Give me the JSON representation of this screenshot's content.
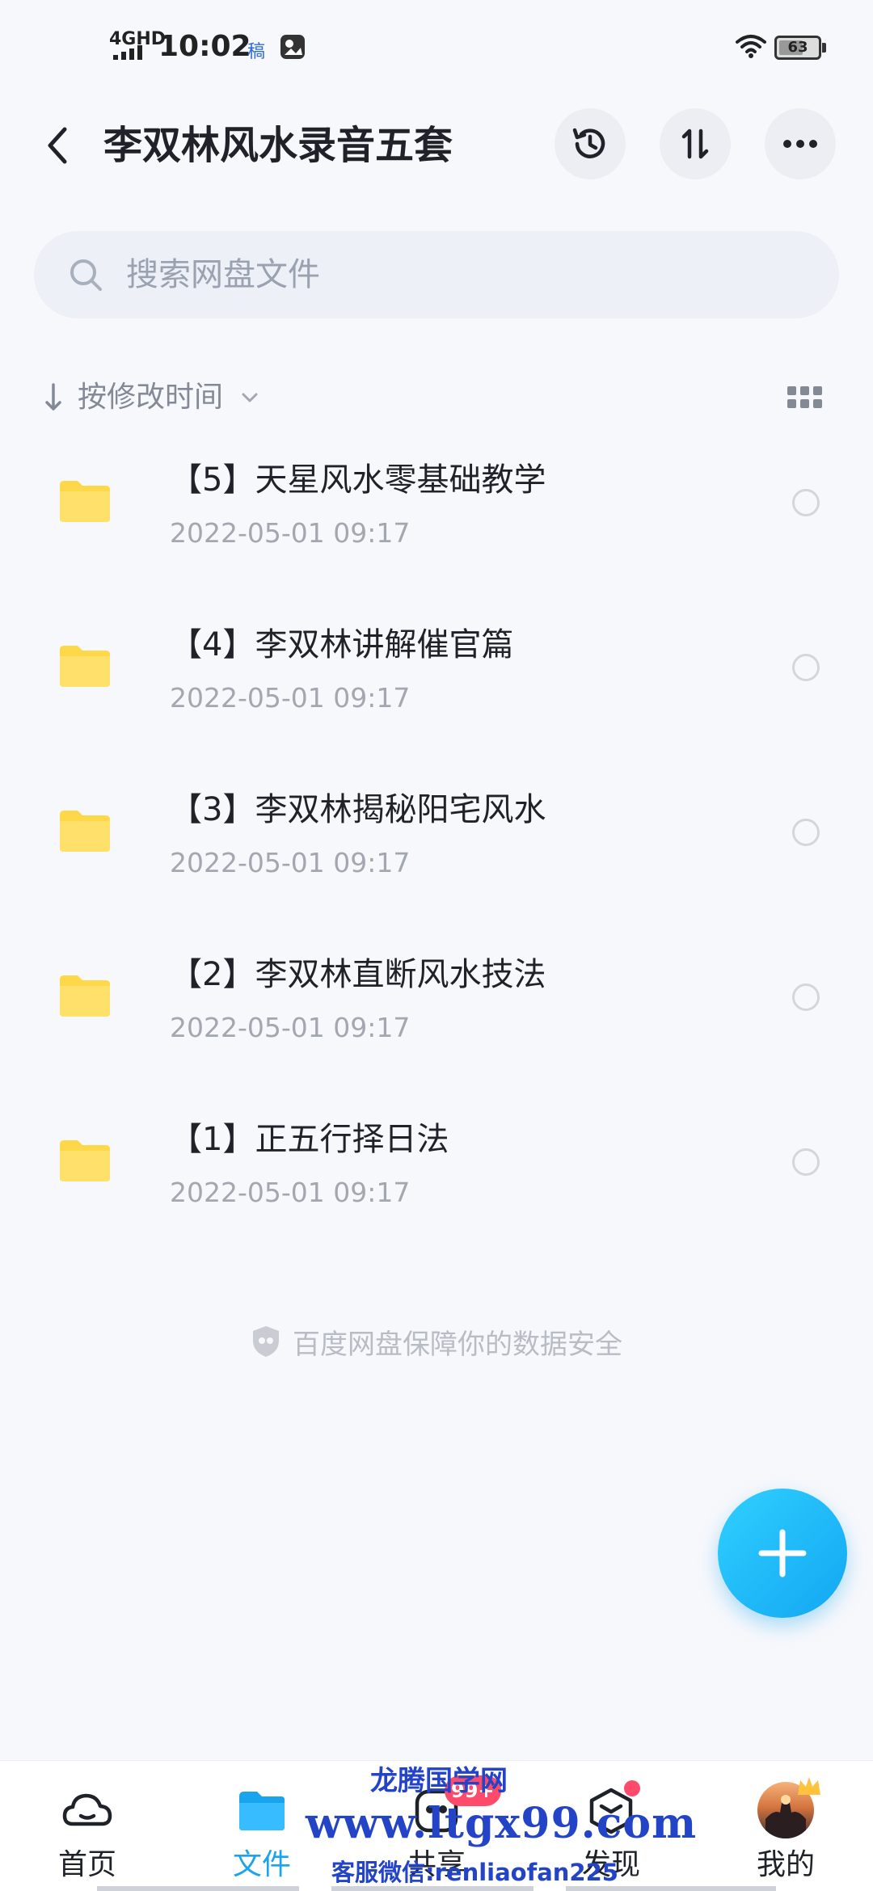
{
  "status_bar": {
    "network": "4GHD",
    "time": "10:02",
    "notification_glyph": "稿",
    "battery": "63",
    "battery_level": 0.63
  },
  "header": {
    "title": "李双林风水录音五套",
    "back_icon": "chevron-left-icon",
    "actions": [
      "history-icon",
      "sort-icon",
      "more-icon"
    ]
  },
  "search": {
    "placeholder": "搜索网盘文件"
  },
  "sort": {
    "label": "按修改时间",
    "view_icon": "grid-view-icon"
  },
  "files": [
    {
      "name": "【5】天星风水零基础教学",
      "date": "2022-05-01  09:17",
      "type": "folder"
    },
    {
      "name": "【4】李双林讲解催官篇",
      "date": "2022-05-01  09:17",
      "type": "folder"
    },
    {
      "name": "【3】李双林揭秘阳宅风水",
      "date": "2022-05-01  09:17",
      "type": "folder"
    },
    {
      "name": "【2】李双林直断风水技法",
      "date": "2022-05-01  09:17",
      "type": "folder"
    },
    {
      "name": "【1】正五行择日法",
      "date": "2022-05-01  09:17",
      "type": "folder"
    }
  ],
  "footer_note": "百度网盘保障你的数据安全",
  "fab_icon": "plus-icon",
  "bottom_nav": {
    "items": [
      {
        "label": "首页",
        "icon": "cloud-home-icon",
        "active": false
      },
      {
        "label": "文件",
        "icon": "folder-icon",
        "active": true
      },
      {
        "label": "共享",
        "icon": "share-icon",
        "active": false,
        "badge": "99+"
      },
      {
        "label": "发现",
        "icon": "discover-icon",
        "active": false
      },
      {
        "label": "我的",
        "icon": "avatar-icon",
        "active": false
      }
    ]
  },
  "watermark": {
    "site": "龙腾国学网",
    "url": "www.ltgx99.com",
    "contact": "客服微信:renliaofan225"
  },
  "colors": {
    "accent": "#1aa3ef",
    "folder": "#ffd84a",
    "badge": "#ff4b6b",
    "background": "#f7f8fc",
    "watermark": "#2444c8"
  }
}
